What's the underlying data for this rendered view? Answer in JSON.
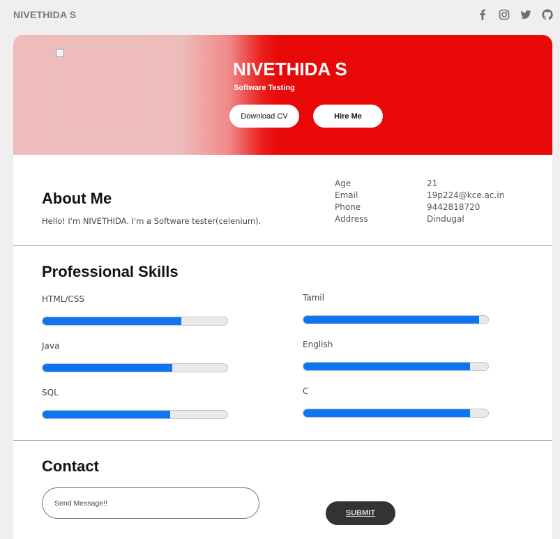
{
  "header": {
    "brand": "NIVETHIDA S",
    "socials": [
      {
        "icon": "facebook-icon"
      },
      {
        "icon": "instagram-icon"
      },
      {
        "icon": "twitter-icon"
      },
      {
        "icon": "github-icon"
      }
    ]
  },
  "hero": {
    "name": "NIVETHIDA S",
    "role": "Software Testing",
    "download_label": "Download CV",
    "hire_label": "Hire Me"
  },
  "about": {
    "title": "About Me",
    "text": "Hello! I'm NIVETHIDA. I'm a Software tester(celenium).",
    "info": [
      {
        "key": "Age",
        "value": "21"
      },
      {
        "key": "Email",
        "value": "19p224@kce.ac.in"
      },
      {
        "key": "Phone",
        "value": "9442818720"
      },
      {
        "key": "Address",
        "value": "Dindugal"
      }
    ]
  },
  "skills": {
    "title": "Professional Skills",
    "left": [
      {
        "name": "HTML/CSS",
        "level": 75
      },
      {
        "name": "Java",
        "level": 70
      },
      {
        "name": "SQL",
        "level": 69
      }
    ],
    "right": [
      {
        "name": "Tamil",
        "level": 95
      },
      {
        "name": "English",
        "level": 90
      },
      {
        "name": "C",
        "level": 90
      }
    ]
  },
  "contact": {
    "title": "Contact",
    "placeholder": "Send Message!!",
    "submit_label": "SUBMIT"
  },
  "colors": {
    "accent_red": "#e80808",
    "bar_blue": "#0d74f2",
    "submit_dark": "#333333"
  }
}
